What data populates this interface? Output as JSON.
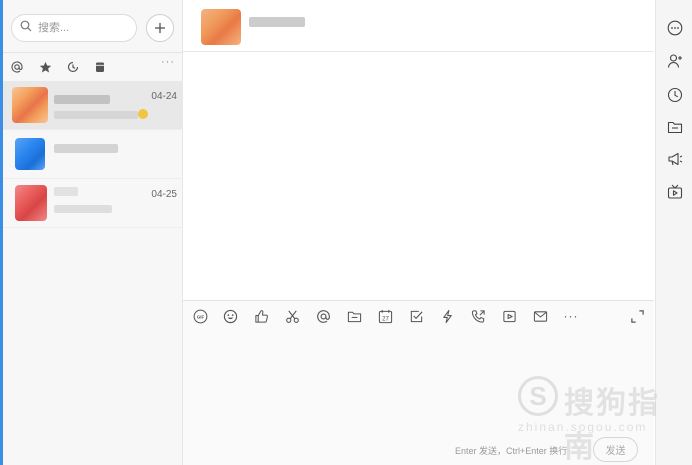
{
  "search": {
    "placeholder": "搜索..."
  },
  "sidebar": {
    "more_label": "···",
    "filters": [
      "at-icon",
      "star-icon",
      "history-icon",
      "archive-icon"
    ]
  },
  "conversations": [
    {
      "date": "04-24",
      "active": true,
      "avatar_colors": [
        "#f4a15e",
        "#e8744a",
        "#f7c79a"
      ]
    },
    {
      "date": "",
      "active": false,
      "avatar_colors": [
        "#2b86f0",
        "#5aa4f5",
        "#1a6fd8"
      ]
    },
    {
      "date": "04-25",
      "active": false,
      "avatar_colors": [
        "#ea5e5e",
        "#f08a8a",
        "#d94545"
      ]
    }
  ],
  "chat": {
    "header_avatar_colors": [
      "#f09a5c",
      "#f5b482",
      "#e97a45"
    ],
    "toolbar": [
      "gif-icon",
      "emoji-icon",
      "thumbs-up-icon",
      "scissors-icon",
      "at-icon",
      "folder-icon",
      "calendar-icon",
      "checkbox-icon",
      "lightning-icon",
      "phone-icon",
      "video-icon",
      "mail-icon",
      "more-icon"
    ],
    "calendar_day": "27",
    "gif_label": "GIF",
    "toolbar_more": "···",
    "hint": "Enter 发送，Ctrl+Enter 换行",
    "send_label": "发送"
  },
  "right_rail": [
    "chat-more-icon",
    "add-member-icon",
    "history-icon",
    "folder-icon",
    "announcement-icon",
    "live-icon"
  ],
  "watermark": {
    "text": "搜狗指南",
    "url": "zhinan.sogou.com",
    "logo": "S"
  },
  "colors": {
    "accent": "#3a8ee6",
    "icon": "#555555"
  }
}
